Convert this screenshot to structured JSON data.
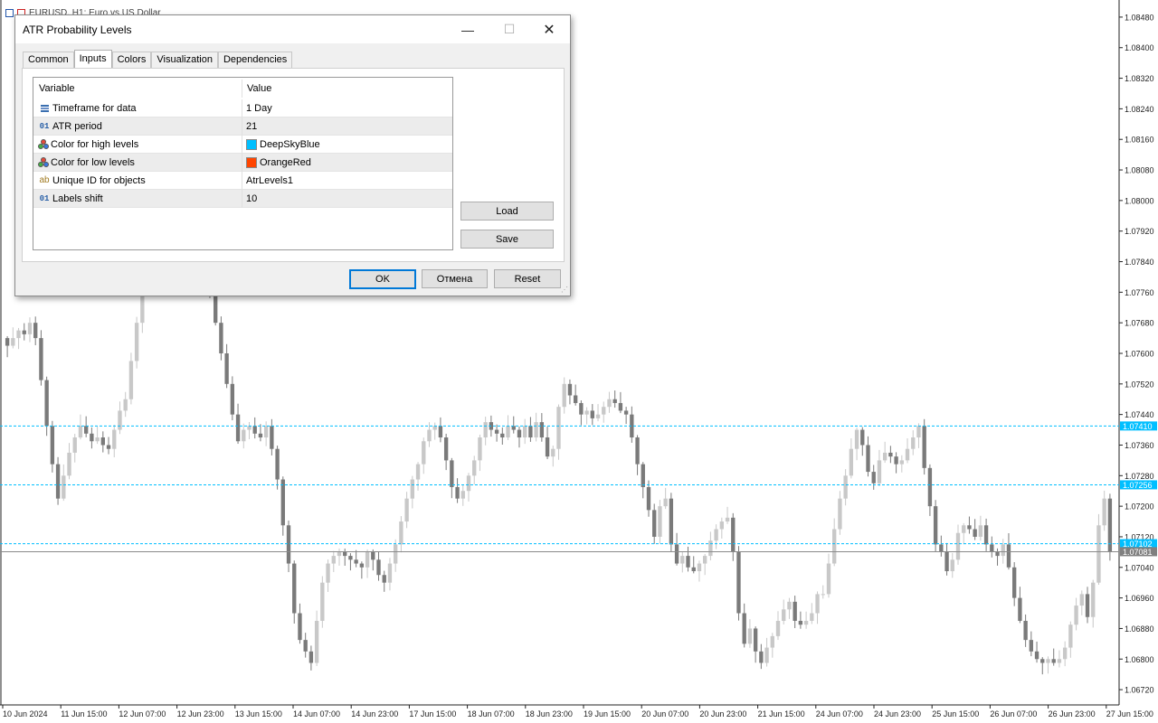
{
  "chart": {
    "window_title": "EURUSD, H1: Euro vs US Dollar",
    "price_labels": [
      "1.08480",
      "1.08400",
      "1.08320",
      "1.08240",
      "1.08160",
      "1.08080",
      "1.08000",
      "1.07920",
      "1.07840",
      "1.07760",
      "1.07680",
      "1.07600",
      "1.07520",
      "1.07440",
      "1.07360",
      "1.07280",
      "1.07200",
      "1.07120",
      "1.07040",
      "1.06960",
      "1.06880",
      "1.06800",
      "1.06720"
    ],
    "time_labels": [
      "10 Jun 2024",
      "11 Jun 15:00",
      "12 Jun 07:00",
      "12 Jun 23:00",
      "13 Jun 15:00",
      "14 Jun 07:00",
      "14 Jun 23:00",
      "17 Jun 15:00",
      "18 Jun 07:00",
      "18 Jun 23:00",
      "19 Jun 15:00",
      "20 Jun 07:00",
      "20 Jun 23:00",
      "21 Jun 15:00",
      "24 Jun 07:00",
      "24 Jun 23:00",
      "25 Jun 15:00",
      "26 Jun 07:00",
      "26 Jun 23:00",
      "27 Jun 15:00"
    ],
    "level_tags": [
      {
        "value": "1.07410",
        "price": 1.0741,
        "color": "#00bfff"
      },
      {
        "value": "1.07256",
        "price": 1.07256,
        "color": "#00bfff"
      },
      {
        "value": "1.07102",
        "price": 1.07102,
        "color": "#00bfff"
      },
      {
        "value": "1.07081",
        "price": 1.07081,
        "color": "#808080"
      }
    ]
  },
  "chart_data": {
    "type": "candlestick",
    "symbol": "EURUSD",
    "timeframe": "H1",
    "price_axis_range": [
      1.0668,
      1.0852
    ],
    "horizontal_levels": [
      1.0741,
      1.07256,
      1.07102,
      1.07081
    ],
    "close_path": [
      1.0762,
      1.0764,
      1.0766,
      1.0765,
      1.0768,
      1.0764,
      1.0753,
      1.0741,
      1.0731,
      1.0722,
      1.0728,
      1.0734,
      1.0738,
      1.0741,
      1.0739,
      1.0737,
      1.0738,
      1.0736,
      1.0735,
      1.074,
      1.0745,
      1.0748,
      1.0758,
      1.0768,
      1.0778,
      1.0792,
      1.0805,
      1.0815,
      1.082,
      1.0822,
      1.0821,
      1.0819,
      1.0815,
      1.0805,
      1.0795,
      1.0785,
      1.0775,
      1.0768,
      1.076,
      1.0752,
      1.0744,
      1.0737,
      1.074,
      1.0741,
      1.0739,
      1.0738,
      1.0741,
      1.0735,
      1.0727,
      1.0715,
      1.0705,
      1.0692,
      1.0685,
      1.0682,
      1.0679,
      1.069,
      1.07,
      1.0705,
      1.0707,
      1.0708,
      1.0707,
      1.0706,
      1.0705,
      1.0704,
      1.0708,
      1.0706,
      1.0702,
      1.07,
      1.0705,
      1.071,
      1.0716,
      1.0722,
      1.0727,
      1.0731,
      1.0737,
      1.074,
      1.0741,
      1.0738,
      1.0732,
      1.0725,
      1.0722,
      1.0724,
      1.0728,
      1.0732,
      1.0738,
      1.0742,
      1.074,
      1.0739,
      1.0738,
      1.0741,
      1.074,
      1.0738,
      1.0741,
      1.0738,
      1.0742,
      1.0738,
      1.0733,
      1.0735,
      1.0746,
      1.0752,
      1.0749,
      1.0747,
      1.0744,
      1.0745,
      1.0743,
      1.0744,
      1.0746,
      1.0748,
      1.0747,
      1.0745,
      1.0744,
      1.0738,
      1.0731,
      1.0725,
      1.0719,
      1.0712,
      1.072,
      1.0722,
      1.071,
      1.0705,
      1.0707,
      1.0704,
      1.0703,
      1.0705,
      1.0707,
      1.0711,
      1.0714,
      1.0716,
      1.0717,
      1.0708,
      1.0692,
      1.0684,
      1.0688,
      1.0682,
      1.0679,
      1.0683,
      1.0686,
      1.069,
      1.0693,
      1.0695,
      1.069,
      1.0689,
      1.069,
      1.0692,
      1.0697,
      1.0697,
      1.0705,
      1.0714,
      1.0722,
      1.0728,
      1.0735,
      1.074,
      1.0736,
      1.0729,
      1.0726,
      1.0732,
      1.0734,
      1.0733,
      1.0731,
      1.0732,
      1.0735,
      1.0738,
      1.0741,
      1.073,
      1.072,
      1.071,
      1.0708,
      1.0703,
      1.0706,
      1.0713,
      1.0715,
      1.0714,
      1.0712,
      1.0715,
      1.071,
      1.0708,
      1.0707,
      1.071,
      1.0704,
      1.0696,
      1.069,
      1.0685,
      1.0682,
      1.068,
      1.0679,
      1.068,
      1.0679,
      1.068,
      1.0683,
      1.0689,
      1.0694,
      1.0697,
      1.0691,
      1.07,
      1.0715,
      1.0722,
      1.0708
    ]
  },
  "dialog": {
    "title": "ATR Probability Levels",
    "window_controls": {
      "minimize": "—",
      "maximize": "☐",
      "close": "✕"
    },
    "tabs": [
      {
        "label": "Common",
        "active": false
      },
      {
        "label": "Inputs",
        "active": true
      },
      {
        "label": "Colors",
        "active": false
      },
      {
        "label": "Visualization",
        "active": false
      },
      {
        "label": "Dependencies",
        "active": false
      }
    ],
    "grid": {
      "header": {
        "variable": "Variable",
        "value": "Value"
      },
      "rows": [
        {
          "icon": "enum-list-icon",
          "variable": "Timeframe for data",
          "value": "1 Day"
        },
        {
          "icon": "integer-icon",
          "icon_text": "01",
          "variable": "ATR period",
          "value": "21"
        },
        {
          "icon": "color-icon",
          "variable": "Color for high levels",
          "value": "DeepSkyBlue",
          "swatch": "#00bfff"
        },
        {
          "icon": "color-icon",
          "variable": "Color for low levels",
          "value": "OrangeRed",
          "swatch": "#ff4500"
        },
        {
          "icon": "string-icon",
          "icon_text": "ab",
          "variable": "Unique ID for objects",
          "value": "AtrLevels1"
        },
        {
          "icon": "integer-icon",
          "icon_text": "01",
          "variable": "Labels shift",
          "value": "10"
        }
      ]
    },
    "buttons": {
      "load": "Load",
      "save": "Save",
      "ok": "OK",
      "cancel": "Отмена",
      "reset": "Reset"
    }
  }
}
